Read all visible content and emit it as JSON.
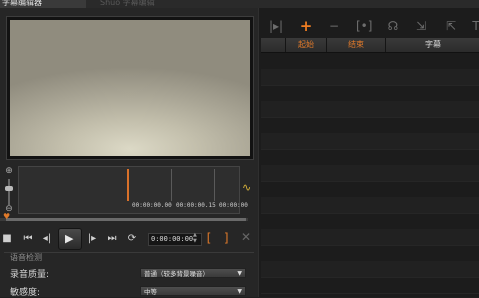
{
  "window": {
    "title": "字幕编辑器",
    "faded_tab": "Shuo  字幕编辑"
  },
  "timeline": {
    "labels": [
      "00:00:00.00",
      "00:00:00.15",
      "00:00:00"
    ]
  },
  "transport": {
    "time": "0:00:00:00",
    "bracket_in": "[",
    "bracket_out": "]"
  },
  "speech_detection": {
    "title": "语音检测",
    "quality_label": "录音质量:",
    "quality_value": "普通（较多背景噪音）",
    "sensitivity_label": "敏感度:",
    "sensitivity_value": "中等"
  },
  "subtitle_table": {
    "columns": [
      "起始",
      "结束",
      "字幕"
    ],
    "row_count": 15
  },
  "colors": {
    "accent_orange": "#ef7d22",
    "column_header_orange": "#e27a2a",
    "column_header_plain": "#d8d8d8"
  }
}
